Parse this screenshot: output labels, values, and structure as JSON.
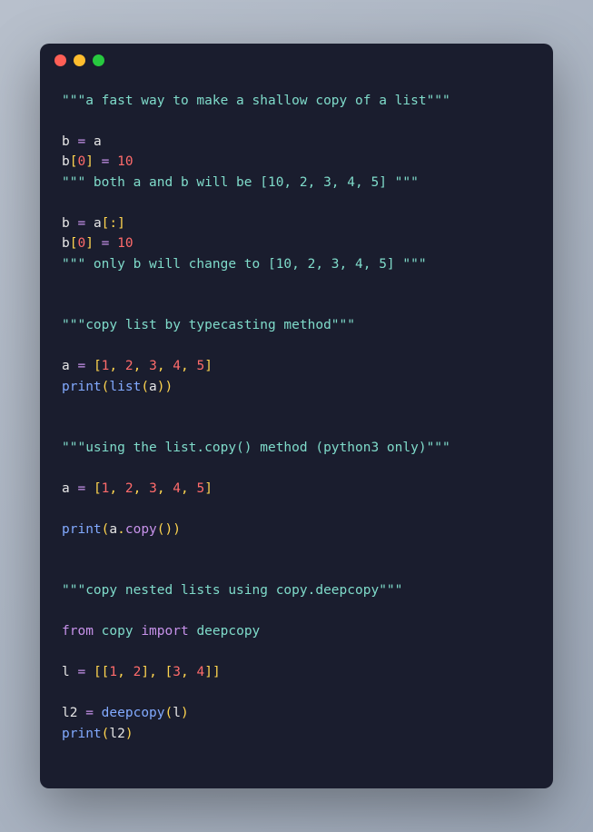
{
  "doc1": "\"\"\"a fast way to make a shallow copy of a list\"\"\"",
  "b": "b",
  "a": "a",
  "eq": " = ",
  "zero": "0",
  "ten": "10",
  "one": "1",
  "two": "2",
  "three": "3",
  "four": "4",
  "five": "5",
  "doc2a": "\"\"\" both a and b will be [10, 2, 3, 4, 5] \"\"\"",
  "doc2b": "\"\"\" only b will change to [10, 2, 3, 4, 5] \"\"\"",
  "doc3": "\"\"\"copy list by typecasting method\"\"\"",
  "doc4": "\"\"\"using the list.copy() method (python3 only)\"\"\"",
  "doc5": "\"\"\"copy nested lists using copy.deepcopy\"\"\"",
  "print": "print",
  "listfn": "list",
  "copyattr": "copy",
  "from": "from",
  "import": "import",
  "deepcopy": "deepcopy",
  "l": "l",
  "l2": "l2",
  "lbr": "[",
  "rbr": "]",
  "lpr": "(",
  "rpr": ")",
  "comma": ", ",
  "colon": ":",
  "dot": "."
}
